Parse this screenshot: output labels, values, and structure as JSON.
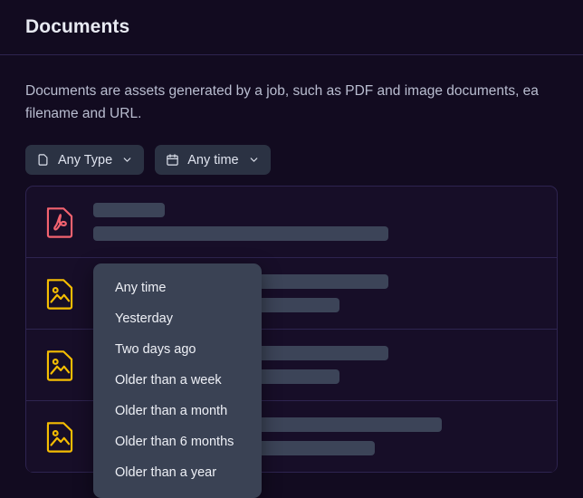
{
  "header": {
    "title": "Documents"
  },
  "main": {
    "description": "Documents are assets generated by a job, such as PDF and image documents, ea\nfilename and URL."
  },
  "filters": [
    {
      "id": "type",
      "label": "Any Type",
      "icon": "file-icon",
      "caret": "chevron-down-icon"
    },
    {
      "id": "time",
      "label": "Any time",
      "icon": "calendar-icon",
      "caret": "chevron-down-icon"
    }
  ],
  "dropdown": {
    "owner": "time",
    "items": [
      {
        "label": "Any time"
      },
      {
        "label": "Yesterday"
      },
      {
        "label": "Two days ago"
      },
      {
        "label": "Older than a week"
      },
      {
        "label": "Older than a month"
      },
      {
        "label": "Older than 6 months"
      },
      {
        "label": "Older than a year"
      }
    ]
  },
  "documents": {
    "loading": true,
    "rows": [
      {
        "icon": "pdf-file-icon",
        "icon_color": "#f2626f",
        "skeletons": [
          {
            "width": "16%"
          },
          {
            "width": "66%"
          }
        ]
      },
      {
        "icon": "image-file-icon",
        "icon_color": "#f5bd02",
        "skeletons": [
          {
            "width": "66%"
          },
          {
            "width": "55%"
          }
        ]
      },
      {
        "icon": "image-file-icon",
        "icon_color": "#f5bd02",
        "skeletons": [
          {
            "width": "66%"
          },
          {
            "width": "55%"
          }
        ]
      },
      {
        "icon": "image-file-icon",
        "icon_color": "#f5bd02",
        "skeletons": [
          {
            "width": "78%"
          },
          {
            "width": "63%"
          }
        ]
      }
    ]
  },
  "colors": {
    "page_background": "#120b20",
    "panel_background": "#170e28",
    "border": "#2e2450",
    "title_text": "#e8eaf2",
    "body_text": "#b9bdd0",
    "filter_button_bg": "#2b3243",
    "dropdown_bg": "#3a4254",
    "skeleton": "#3c4458",
    "pdf_icon": "#f2626f",
    "image_icon": "#f5bd02"
  }
}
